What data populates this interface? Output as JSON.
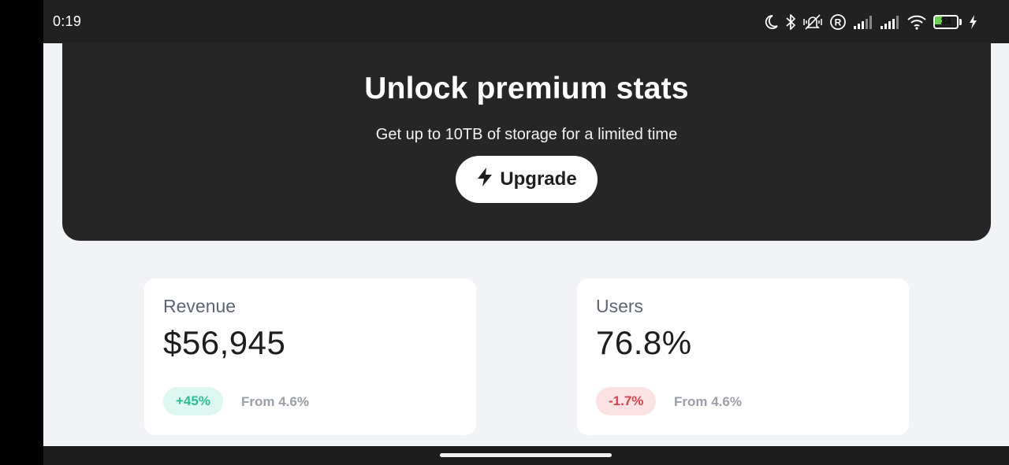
{
  "status_bar": {
    "time": "0:19",
    "battery_level": "34",
    "icons": [
      "moon-icon",
      "bluetooth-icon",
      "mute-vibrate-icon",
      "registered-icon",
      "signal-icon",
      "signal-icon",
      "wifi-icon",
      "battery-icon",
      "charging-icon"
    ]
  },
  "banner": {
    "title": "Unlock premium stats",
    "subtitle": "Get up to 10TB of storage for a limited time",
    "button_label": "Upgrade",
    "button_icon": "lightning-icon"
  },
  "stats": [
    {
      "label": "Revenue",
      "value": "$56,945",
      "change": "+45%",
      "change_direction": "up",
      "from": "From 4.6%"
    },
    {
      "label": "Users",
      "value": "76.8%",
      "change": "-1.7%",
      "change_direction": "down",
      "from": "From 4.6%"
    }
  ],
  "colors": {
    "banner_bg": "#262626",
    "page_bg": "#f2f3f7",
    "positive": "#2bbf8f",
    "negative": "#d6424e"
  }
}
